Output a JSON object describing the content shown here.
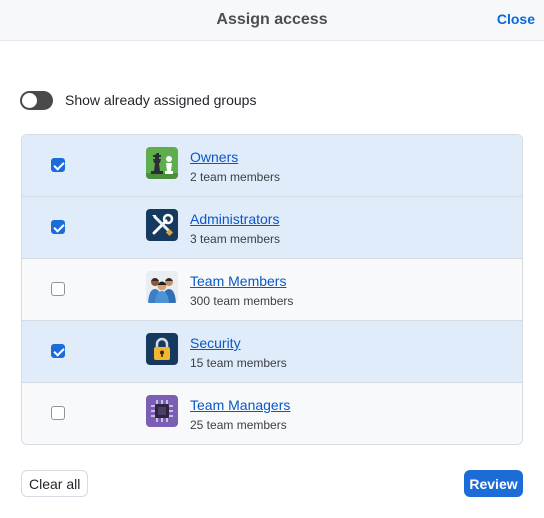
{
  "header": {
    "title": "Assign access",
    "close_label": "Close"
  },
  "toggle": {
    "label": "Show already assigned groups",
    "on": false
  },
  "groups": [
    {
      "name": "Owners",
      "members": "2 team members",
      "checked": true,
      "icon": "chess-pieces-icon"
    },
    {
      "name": "Administrators",
      "members": "3 team members",
      "checked": true,
      "icon": "tools-icon"
    },
    {
      "name": "Team Members",
      "members": "300 team members",
      "checked": false,
      "icon": "people-icon"
    },
    {
      "name": "Security",
      "members": "15 team members",
      "checked": true,
      "icon": "padlock-icon"
    },
    {
      "name": "Team Managers",
      "members": "25 team members",
      "checked": false,
      "icon": "chip-icon"
    }
  ],
  "footer": {
    "clear_label": "Clear all",
    "review_label": "Review"
  },
  "colors": {
    "accent": "#1c6cd8",
    "link": "#0b57c7",
    "selected_row": "#e1ecfb"
  }
}
